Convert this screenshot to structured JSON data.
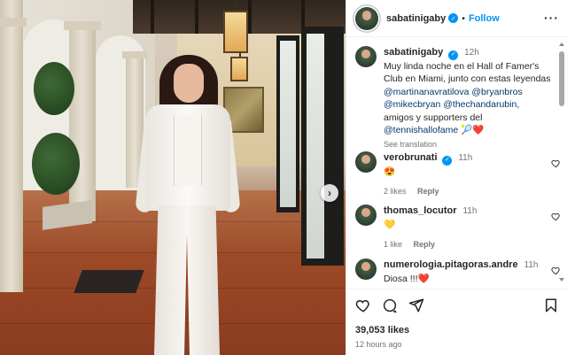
{
  "post": {
    "username": "sabatinigaby",
    "follow_label": "Follow",
    "dot": "•",
    "more_label": "···",
    "caption_time": "12h",
    "caption_lines": [
      "Muy linda noche en el Hall of Famer's",
      "Club en Miami, junto con estas leyendas"
    ],
    "mentions_line1": [
      "@martinanavratilova",
      "@bryanbros"
    ],
    "mentions_line2": [
      "@mikecbryan",
      "@thechandarubin"
    ],
    "mentions_line2_suffix": ",",
    "caption_after": "amigos y supporters del",
    "mention_last": "@tennishallofame",
    "caption_emoji": "🎾❤️",
    "see_translation": "See translation",
    "likes": "39,053 likes",
    "posted_ago": "12 hours ago",
    "next_label": "›"
  },
  "comments": [
    {
      "username": "verobrunati",
      "verified": true,
      "time": "11h",
      "text": "😍",
      "likes": "2 likes",
      "reply": "Reply"
    },
    {
      "username": "thomas_locutor",
      "verified": false,
      "time": "11h",
      "text": "💛",
      "likes": "1 like",
      "reply": "Reply"
    },
    {
      "username": "numerologia.pitagoras.andre",
      "verified": false,
      "time": "11h",
      "text": "Diosa !!!❤️",
      "likes": "",
      "reply": ""
    }
  ],
  "colors": {
    "accent": "#0095f6",
    "text": "#262626",
    "secondary": "#737373",
    "mention": "#00376b",
    "heart": "#ed4956"
  },
  "icons": {
    "header": [
      "verified-badge",
      "more-options-icon"
    ],
    "actions": [
      "heart-icon",
      "comment-icon",
      "share-icon",
      "bookmark-icon"
    ],
    "comment_like": "heart-outline-icon"
  }
}
